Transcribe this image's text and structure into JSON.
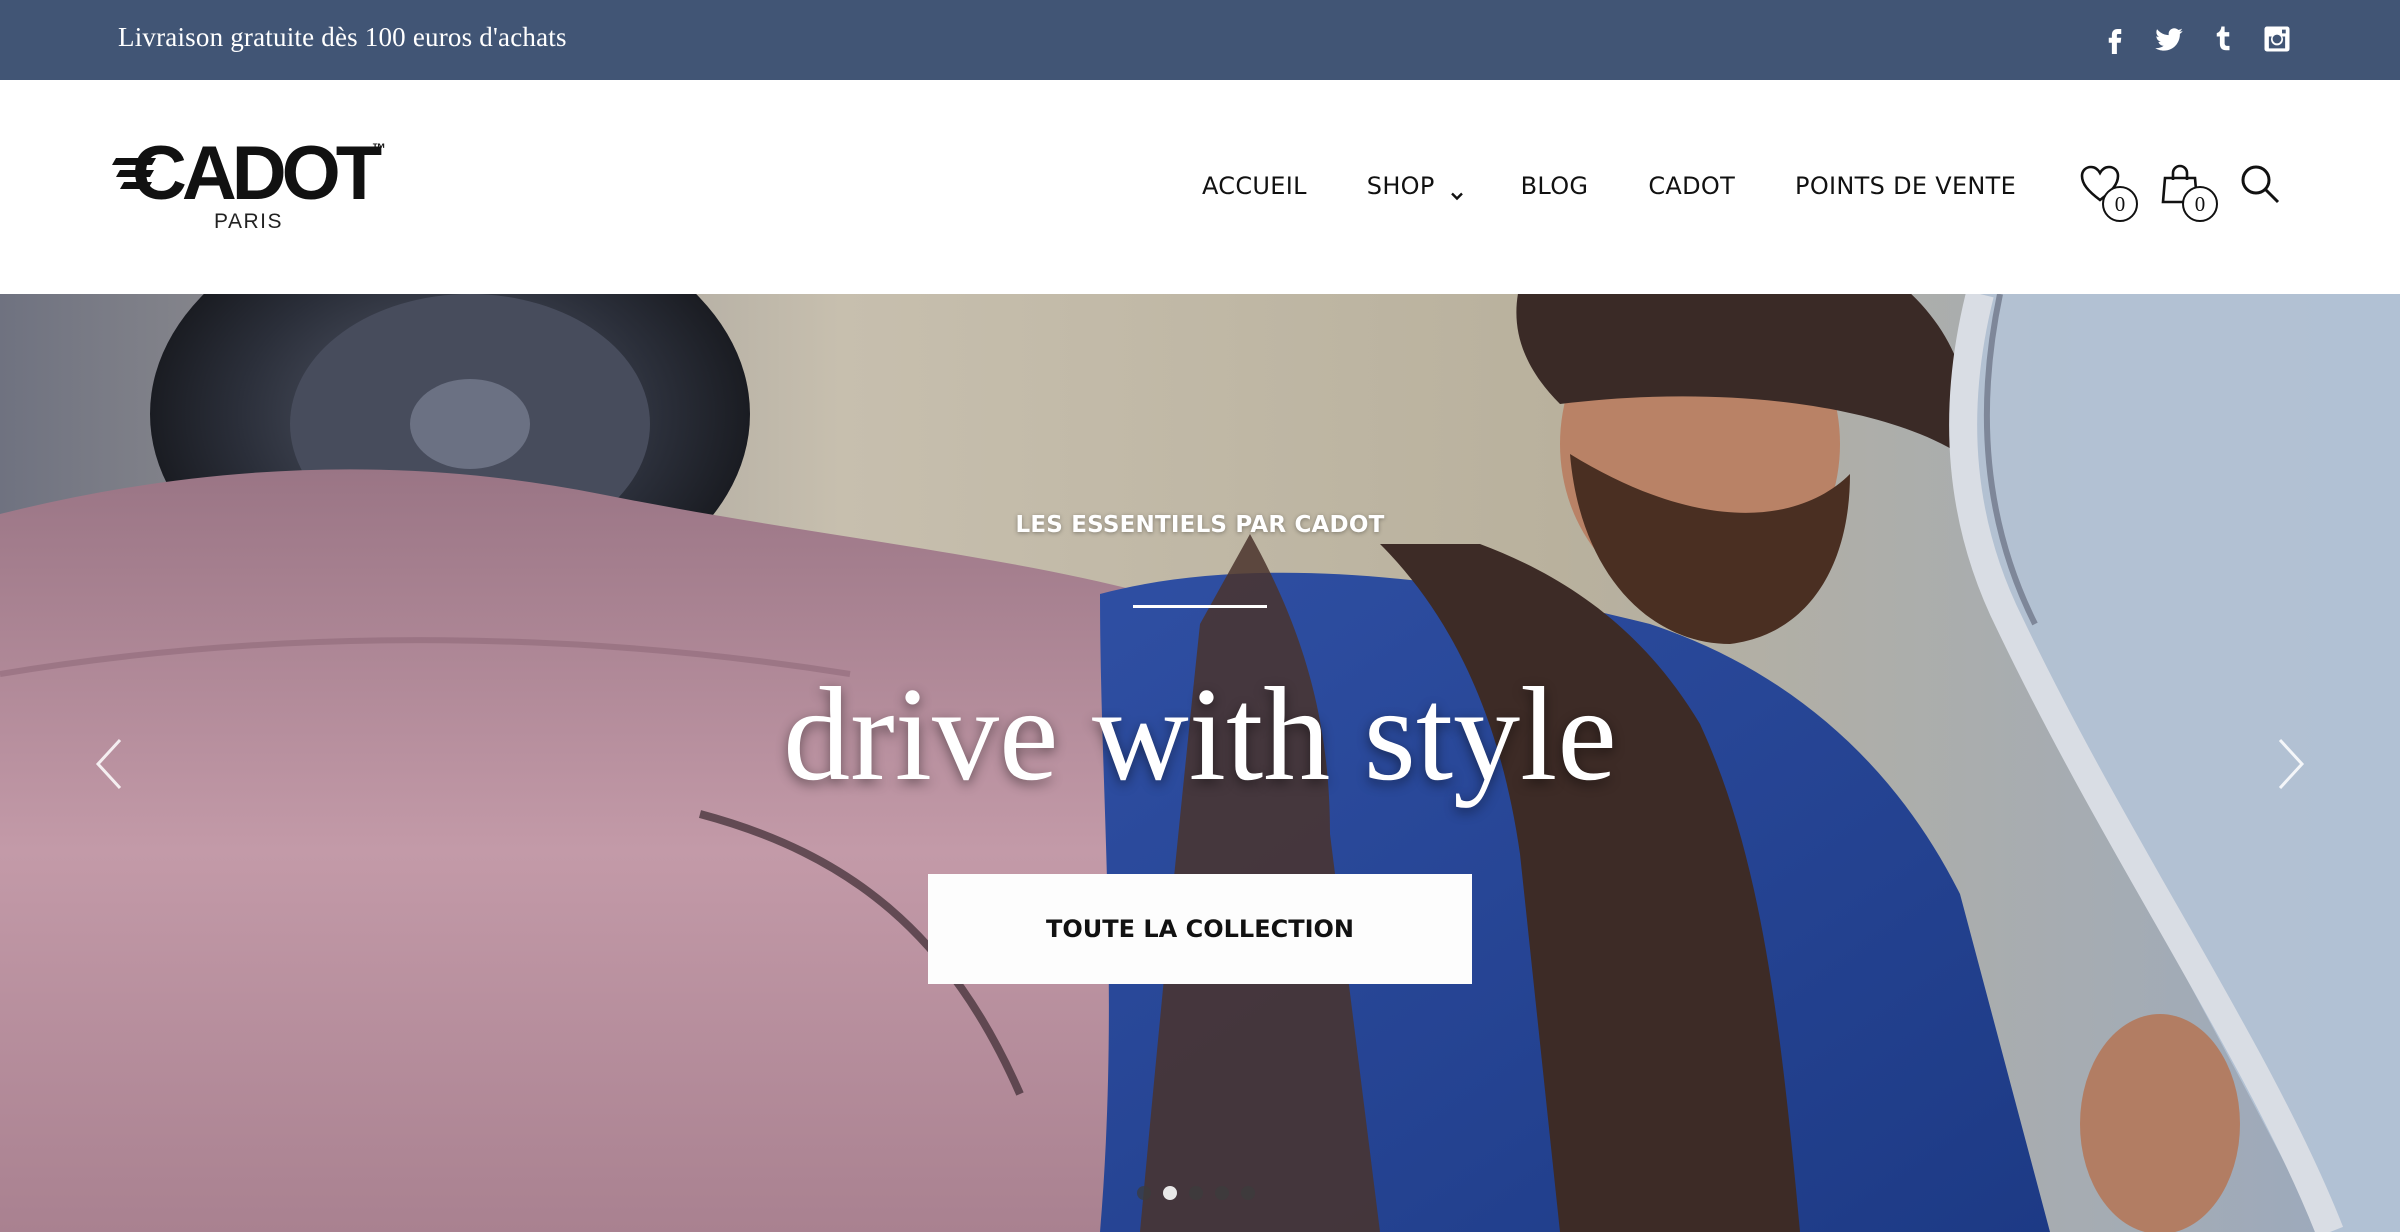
{
  "topbar": {
    "promo_text": "Livraison gratuite dès 100 euros d'achats",
    "background": "#415575",
    "socials": [
      "facebook-icon",
      "twitter-icon",
      "tumblr-icon",
      "instagram-icon"
    ]
  },
  "header": {
    "logo": {
      "wordmark": "CADOT",
      "trademark": "™",
      "city": "PARIS"
    },
    "nav": {
      "accueil": "ACCUEIL",
      "shop": "SHOP",
      "blog": "BLOG",
      "cadot": "CADOT",
      "points_de_vente": "POINTS DE VENTE"
    },
    "wishlist_count": "0",
    "cart_count": "0",
    "icons": [
      "heart-icon",
      "shopping-bag-icon",
      "search-icon"
    ]
  },
  "hero": {
    "eyebrow": "LES ESSENTIELS PAR CADOT",
    "title": "drive with style",
    "cta_label": "TOUTE LA COLLECTION",
    "slide_count": 5,
    "active_slide": 2
  }
}
